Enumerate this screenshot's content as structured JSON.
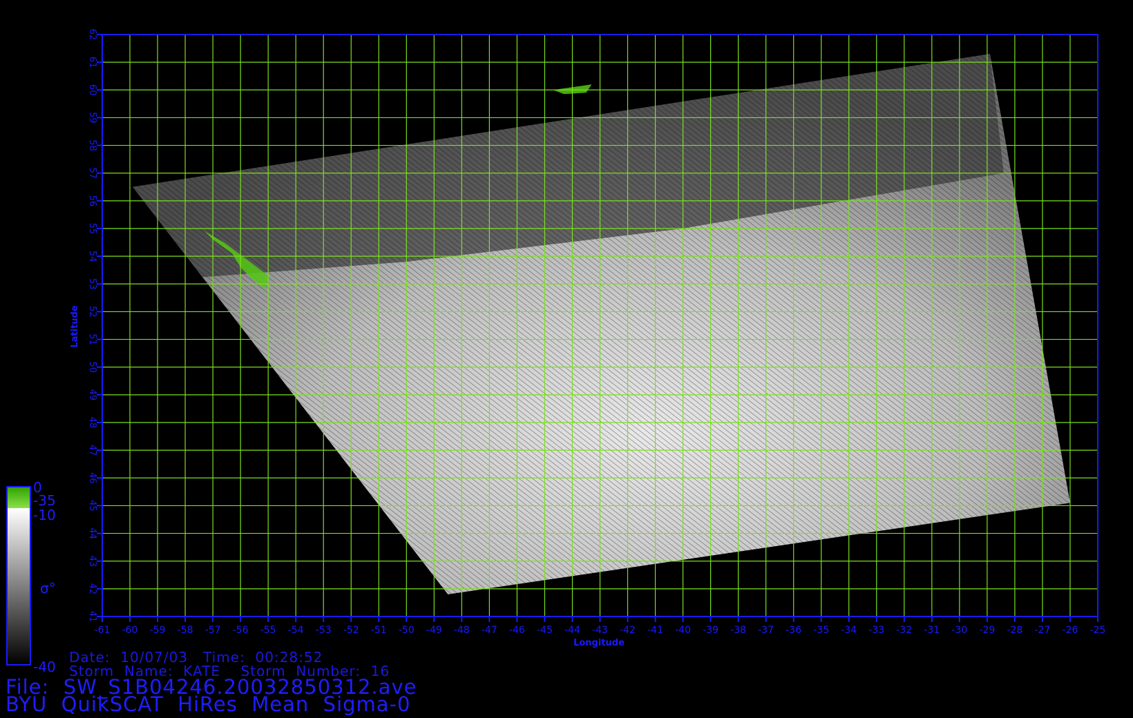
{
  "map": {
    "longitude_ticks": [
      "-61",
      "-60",
      "-59",
      "-58",
      "-57",
      "-56",
      "-55",
      "-54",
      "-53",
      "-52",
      "-51",
      "-50",
      "-49",
      "-48",
      "-47",
      "-46",
      "-45",
      "-44",
      "-43",
      "-42",
      "-41",
      "-40",
      "-39",
      "-38",
      "-37",
      "-36",
      "-35",
      "-34",
      "-33",
      "-32",
      "-31",
      "-30",
      "-29",
      "-28",
      "-27",
      "-26",
      "-25"
    ],
    "latitude_ticks": [
      "41",
      "42",
      "43",
      "44",
      "45",
      "46",
      "47",
      "48",
      "49",
      "50",
      "51",
      "52",
      "53",
      "54",
      "55",
      "56",
      "57",
      "58",
      "59",
      "60",
      "61",
      "62"
    ],
    "xlabel": "Longitude",
    "ylabel": "Latitude",
    "lon_range": [
      -61,
      -25
    ],
    "lat_range": [
      41,
      62
    ],
    "swath_corners_lonlat": [
      [
        -59.9,
        56.5
      ],
      [
        -28.9,
        61.3
      ],
      [
        -26.0,
        45.1
      ],
      [
        -48.5,
        41.8
      ]
    ],
    "colors": {
      "grid": "#7be01f",
      "axis": "#1a1aff",
      "text": "#1e1eff",
      "land": "#5ad010",
      "background": "#000000"
    }
  },
  "colorbar": {
    "labels": {
      "top": "0",
      "land_threshold": "-35",
      "upper": "-10",
      "symbol": "σ°",
      "bottom": "-40"
    },
    "gradient": [
      "#ffffff",
      "#000000"
    ],
    "land_color": "#4fbf12"
  },
  "info": {
    "date_line": "Date:  10/07/03   Time:  00:28:52",
    "storm_line": "Storm  Name:  KATE    Storm  Number:  16",
    "file_line": "File:  SW_S1B04246.20032850312.ave",
    "title_line": "BYU  QuikSCAT  HiRes  Mean  Sigma-0"
  }
}
